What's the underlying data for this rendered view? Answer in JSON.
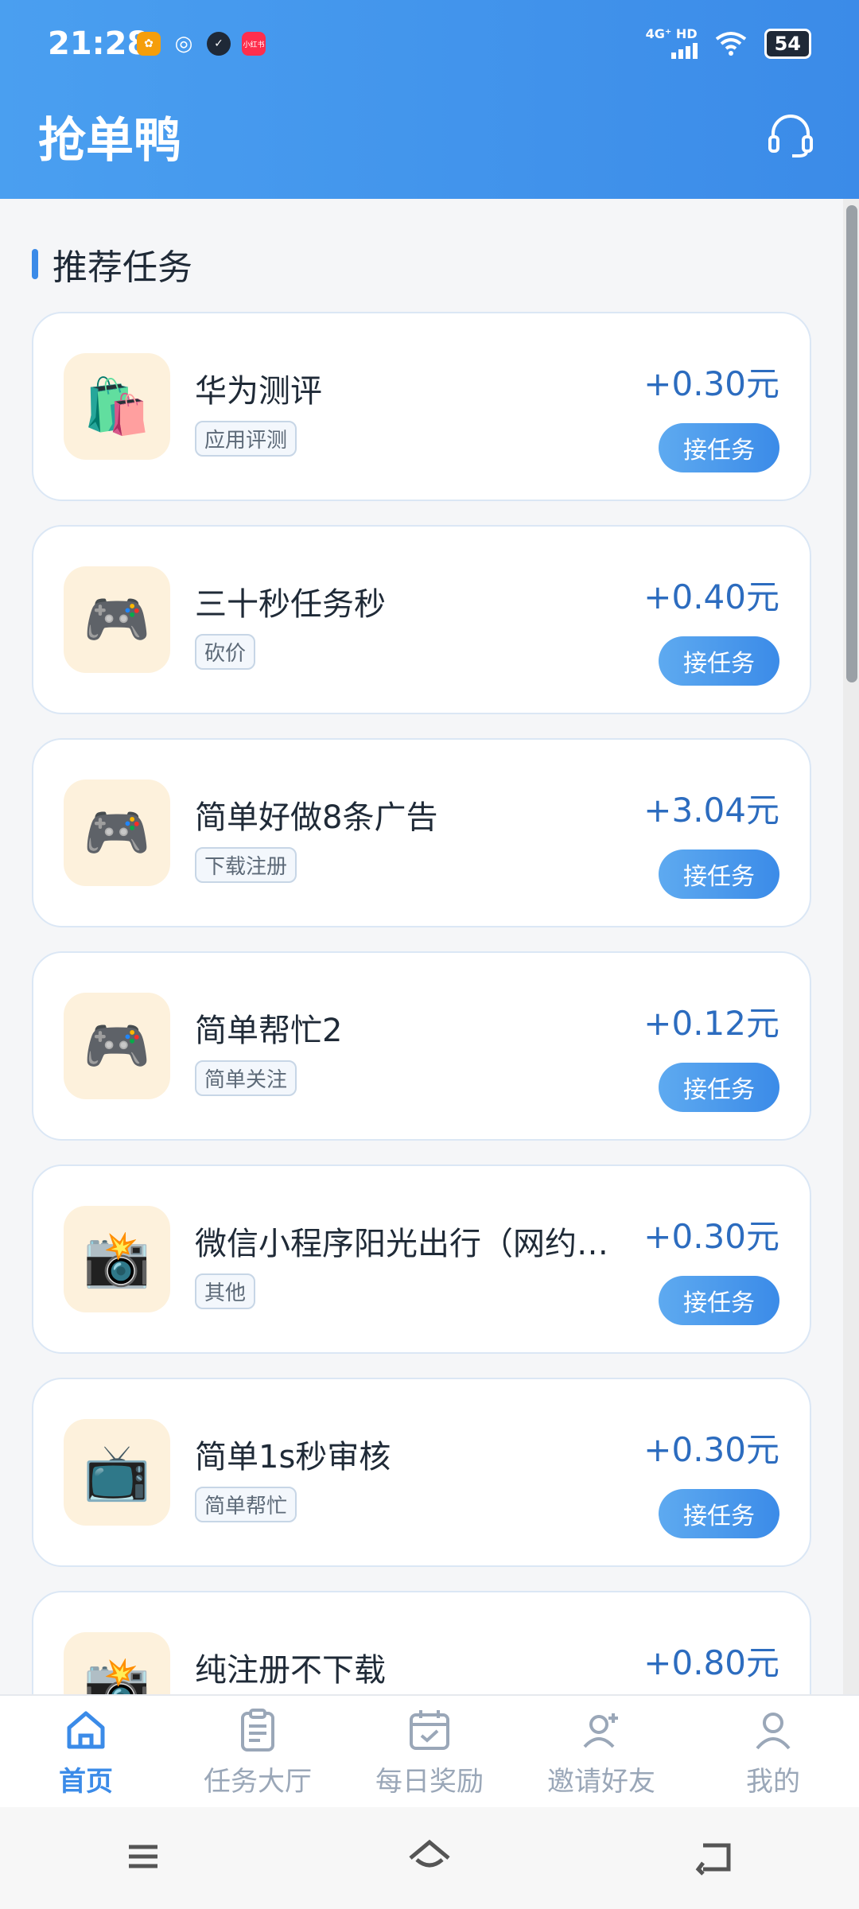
{
  "status_bar": {
    "time": "21:28",
    "network": "4G⁺ HD",
    "battery": "54",
    "app_icon_label": "小红书"
  },
  "header": {
    "title": "抢单鸭",
    "support_icon": "headset-icon"
  },
  "section": {
    "title": "推荐任务"
  },
  "accept_label": "接任务",
  "tasks": [
    {
      "name": "华为测评",
      "tag": "应用评测",
      "reward": "+0.30元",
      "icon": "🛍️"
    },
    {
      "name": "三十秒任务秒",
      "tag": "砍价",
      "reward": "+0.40元",
      "icon": "🎮"
    },
    {
      "name": "简单好做8条广告",
      "tag": "下载注册",
      "reward": "+3.04元",
      "icon": "🎮"
    },
    {
      "name": "简单帮忙2",
      "tag": "简单关注",
      "reward": "+0.12元",
      "icon": "🎮"
    },
    {
      "name": "微信小程序阳光出行（网约…",
      "tag": "其他",
      "reward": "+0.30元",
      "icon": "📸"
    },
    {
      "name": "简单1s秒审核",
      "tag": "简单帮忙",
      "reward": "+0.30元",
      "icon": "📺"
    },
    {
      "name": "纯注册不下载",
      "tag": "",
      "reward": "+0.80元",
      "icon": "📸"
    }
  ],
  "tabs": [
    {
      "label": "首页",
      "icon": "home-icon",
      "active": true
    },
    {
      "label": "任务大厅",
      "icon": "clipboard-icon",
      "active": false
    },
    {
      "label": "每日奖励",
      "icon": "calendar-check-icon",
      "active": false
    },
    {
      "label": "邀请好友",
      "icon": "add-user-icon",
      "active": false
    },
    {
      "label": "我的",
      "icon": "user-icon",
      "active": false
    }
  ],
  "colors": {
    "accent": "#3b8be8",
    "reward": "#2c6cbf",
    "thumb_bg": "#fdf1dc"
  }
}
